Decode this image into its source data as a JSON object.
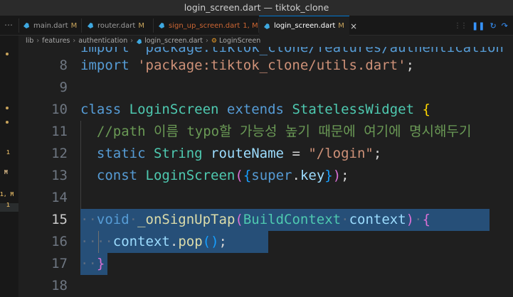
{
  "window": {
    "title": "login_screen.dart — tiktok_clone"
  },
  "tabs": [
    {
      "name": "main.dart",
      "status": "M",
      "status_kind": "modified",
      "active": false
    },
    {
      "name": "router.dart",
      "status": "M",
      "status_kind": "modified",
      "active": false
    },
    {
      "name": "sign_up_screen.dart",
      "status": "1, M",
      "status_kind": "error",
      "active": false
    },
    {
      "name": "login_screen.dart",
      "status": "M",
      "status_kind": "modified",
      "active": true
    }
  ],
  "breadcrumb": [
    "lib",
    "features",
    "authentication",
    "login_screen.dart",
    "LoginScreen"
  ],
  "gutter_marks": [
    "1",
    "M",
    "1, M",
    "1"
  ],
  "editor": {
    "partial_top_line": "import 'package:tiktok_clone/features/authentication",
    "lines": [
      {
        "number": "8",
        "tokens": [
          [
            "kw",
            "import "
          ],
          [
            "str",
            "'package:tiktok_clone/utils.dart'"
          ],
          [
            "pl",
            ";"
          ]
        ]
      },
      {
        "number": "9",
        "tokens": []
      },
      {
        "number": "10",
        "tokens": [
          [
            "kw",
            "class "
          ],
          [
            "type",
            "LoginScreen "
          ],
          [
            "kw",
            "extends "
          ],
          [
            "type",
            "StatelessWidget "
          ],
          [
            "b1",
            "{"
          ]
        ]
      },
      {
        "number": "11",
        "tokens": [
          [
            "pl",
            "  "
          ],
          [
            "cmt",
            "//path 이름 typo할 가능성 높기 때문에 여기에 명시해두기"
          ]
        ]
      },
      {
        "number": "12",
        "tokens": [
          [
            "pl",
            "  "
          ],
          [
            "kw",
            "static "
          ],
          [
            "type",
            "String "
          ],
          [
            "var",
            "routeName"
          ],
          [
            "pl",
            " = "
          ],
          [
            "str",
            "\"/login\""
          ],
          [
            "pl",
            ";"
          ]
        ]
      },
      {
        "number": "13",
        "tokens": [
          [
            "pl",
            "  "
          ],
          [
            "kw",
            "const "
          ],
          [
            "type",
            "LoginScreen"
          ],
          [
            "b2",
            "("
          ],
          [
            "b3",
            "{"
          ],
          [
            "kw",
            "super"
          ],
          [
            "pl",
            "."
          ],
          [
            "var",
            "key"
          ],
          [
            "b3",
            "}"
          ],
          [
            "b2",
            ")"
          ],
          [
            "pl",
            ";"
          ]
        ]
      },
      {
        "number": "14",
        "tokens": []
      },
      {
        "number": "15",
        "tokens": [
          [
            "ws",
            "··"
          ],
          [
            "kw",
            "void"
          ],
          [
            "ws",
            "·"
          ],
          [
            "fn",
            "_onSignUpTap"
          ],
          [
            "b2",
            "("
          ],
          [
            "type",
            "BuildContext"
          ],
          [
            "ws",
            "·"
          ],
          [
            "var",
            "context"
          ],
          [
            "b2",
            ")"
          ],
          [
            "ws",
            "·"
          ],
          [
            "b2",
            "{"
          ]
        ]
      },
      {
        "number": "16",
        "tokens": [
          [
            "ws",
            "··"
          ],
          [
            "ws",
            "··"
          ],
          [
            "var",
            "context"
          ],
          [
            "pl",
            "."
          ],
          [
            "fn",
            "pop"
          ],
          [
            "b3",
            "()"
          ],
          [
            "pl",
            ";"
          ]
        ]
      },
      {
        "number": "17",
        "tokens": [
          [
            "ws",
            "··"
          ],
          [
            "b2",
            "}"
          ]
        ]
      },
      {
        "number": "18",
        "tokens": []
      }
    ]
  }
}
